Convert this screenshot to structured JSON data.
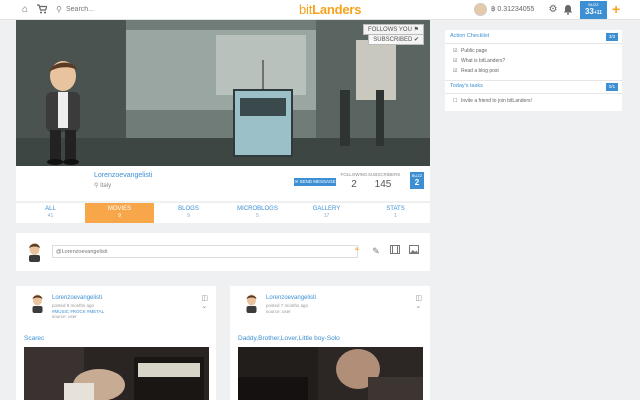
{
  "topbar": {
    "home_icon": "home-icon",
    "cart_icon": "cart-icon",
    "search_placeholder": "Search...",
    "logo_prefix": "bit",
    "logo_suffix": "Landers",
    "balance": "0.31234055",
    "buzz_label": "BUZZ",
    "buzz_value": "33",
    "buzz_delta": "+11",
    "accent": "#3d8fd4",
    "brand": "#f7a21b"
  },
  "profile": {
    "follows_you": "FOLLOWS YOU",
    "subscribed": "SUBSCRIBED",
    "name": "Lorenzoevangelisti",
    "location": "Italy",
    "send_message": "SEND MESSAGE",
    "following_label": "FOLLOWING",
    "following_value": "2",
    "subscribers_label": "SUBSCRIBERS",
    "subscribers_value": "145",
    "buzz_label": "BUZZ",
    "buzz_value": "2"
  },
  "tabs": [
    {
      "label": "ALL",
      "count": "41"
    },
    {
      "label": "MOVIES",
      "count": "9"
    },
    {
      "label": "BLOGS",
      "count": "9"
    },
    {
      "label": "MICROBLOGS",
      "count": "5"
    },
    {
      "label": "GALLERY",
      "count": "17"
    },
    {
      "label": "STATS",
      "count": "1"
    }
  ],
  "composer": {
    "placeholder": "@Lorenzoevangelisti"
  },
  "posts": [
    {
      "author": "Lorenzoevangelisti",
      "posted": "posted 9 months ago",
      "tags": "#MUSIC #ROCK #METAL",
      "source": "source: user",
      "title": "Scarec"
    },
    {
      "author": "Lorenzoevangelisti",
      "posted": "posted 7 months ago",
      "tags": "",
      "source": "source: user",
      "title": "Daddy,Brother,Lover,Little boy-Solo"
    }
  ],
  "sidebar": {
    "checklist_title": "Action Checklist",
    "checklist_count": "3/3",
    "checklist_items": [
      "Public page",
      "What is bitLanders?",
      "Read a blog post"
    ],
    "tasks_title": "Today's tasks",
    "tasks_count": "0/1",
    "tasks_items": [
      "Invite a friend to join bitLanders!"
    ]
  }
}
